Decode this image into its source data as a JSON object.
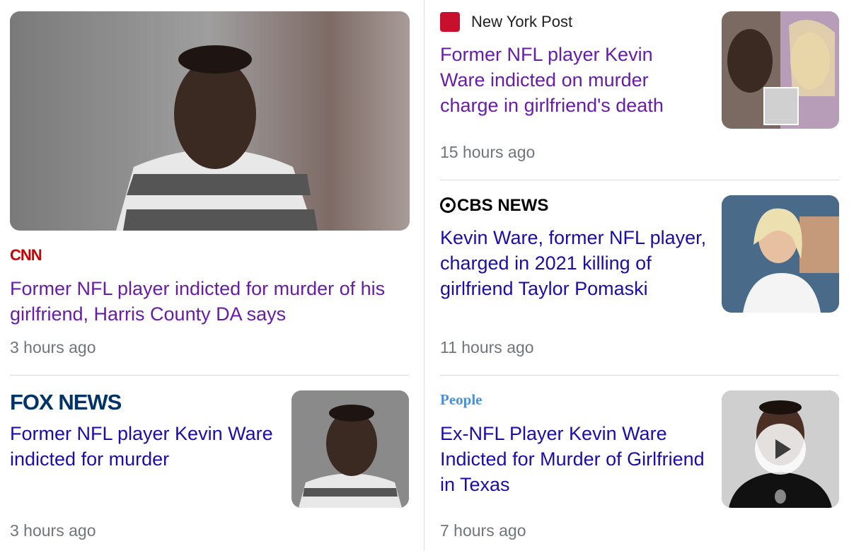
{
  "articles": [
    {
      "source": "CNN",
      "headline": "Former NFL player indicted for murder of his girlfriend, Harris County DA says",
      "time": "3 hours ago"
    },
    {
      "source": "New York Post",
      "headline": "Former NFL player Kevin Ware indicted on murder charge in girlfriend's death",
      "time": "15 hours ago"
    },
    {
      "source": "CBS NEWS",
      "headline": "Kevin Ware, former NFL player, charged in 2021 killing of girlfriend Taylor Pomaski",
      "time": "11 hours ago"
    },
    {
      "source": "FOX NEWS",
      "headline": "Former NFL player Kevin Ware indicted for murder",
      "time": "3 hours ago"
    },
    {
      "source": "People",
      "headline": "Ex-NFL Player Kevin Ware Indicted for Murder of Girlfriend in Texas",
      "time": "7 hours ago"
    }
  ],
  "icons": {
    "video": "play-icon",
    "nypost": "new-york-post-icon"
  },
  "colors": {
    "visited": "#681da8",
    "unvisited": "#1a0dab",
    "cnn": "#cc0000",
    "fox": "#003366",
    "people": "#4a90d9"
  }
}
